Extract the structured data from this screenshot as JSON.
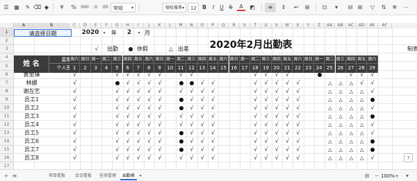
{
  "toolbar": {
    "format_select": "常规",
    "font_family": "微软雅黑",
    "font_size": "12",
    "bold": "B",
    "italic": "I",
    "underline": "U",
    "strike": "S",
    "font_color": "A",
    "percent": "%",
    "thousands": "000",
    "decimal_inc": ".0",
    "decimal_dec": ".00"
  },
  "columns": [
    "A",
    "B",
    "C",
    "D",
    "E",
    "F",
    "G",
    "H",
    "I",
    "J",
    "K",
    "L",
    "M",
    "N",
    "O",
    "P",
    "Q",
    "R",
    "S",
    "T",
    "U",
    "V",
    "W",
    "X",
    "Y",
    "Z",
    "AA",
    "AB",
    "AC",
    "AD",
    "AE",
    "AF"
  ],
  "rows": [
    "1",
    "2",
    "3",
    "4",
    "5",
    "6",
    "7",
    "8",
    "9",
    "10",
    "11",
    "12",
    "13",
    "14",
    "15",
    "16",
    "17"
  ],
  "sheet": {
    "select_date_label": "请选择日期",
    "year_value": "2020",
    "year_unit": "年",
    "month_value": "2",
    "month_unit": "月",
    "title": "2020年2月出勤表",
    "legend": [
      {
        "symbol": "√",
        "label": "出勤"
      },
      {
        "symbol": "●",
        "label": "休假"
      },
      {
        "symbol": "△",
        "label": "出差"
      }
    ],
    "right_label": "制表",
    "name_header": "姓 名",
    "weekday_header": "星期",
    "sign_header": "个人签字",
    "weekdays": [
      "周六",
      "周日",
      "周一",
      "周二",
      "周三",
      "周四",
      "周五",
      "周六",
      "周日",
      "周一",
      "周二",
      "周三",
      "周四",
      "周五",
      "周六",
      "周日",
      "周一",
      "周二",
      "周三",
      "周四",
      "周五",
      "周六",
      "周日",
      "周一",
      "周二",
      "周三",
      "周四",
      "周五",
      "周六"
    ],
    "days": [
      "1",
      "2",
      "3",
      "4",
      "5",
      "6",
      "7",
      "8",
      "9",
      "10",
      "11",
      "12",
      "13",
      "14",
      "15",
      "16",
      "17",
      "18",
      "19",
      "20",
      "21",
      "22",
      "23",
      "24",
      "25",
      "26",
      "27",
      "28",
      "29"
    ],
    "employees": [
      {
        "name": "黄金锋",
        "marks": "c...ccccc.cc.....cccc..d..ccccc"
      },
      {
        "name": "林娜",
        "marks": "c...dcccc.ddcc...ccccc..tttcc"
      },
      {
        "name": "谢左艺",
        "marks": "c...ccccc.cccc...ccccc..ttttc"
      },
      {
        "name": "员工1",
        "marks": "c...ccccc.dccc...ccccc..ttttd"
      },
      {
        "name": "员工2",
        "marks": "c...ccccc.dccc...ccccc..ttttc"
      },
      {
        "name": "员工3",
        "marks": "c...ccccc.cccc...ccccc..ttttd"
      },
      {
        "name": "员工4",
        "marks": "c...ccccc.cccc...ccccc..ttttc"
      },
      {
        "name": "员工5",
        "marks": "c...ccccc.dccc...ccccc..ttttc"
      },
      {
        "name": "员工6",
        "marks": "c...ccccc.dccc...ccccc..ttttd"
      },
      {
        "name": "员工7",
        "marks": "c...ccccc.dccc...ccccc..ttttd"
      },
      {
        "name": "员工8",
        "marks": "c...ccccc.cccc...ccccc..ttttc"
      }
    ]
  },
  "sheet_tabs": [
    {
      "label": "项目看板",
      "active": false
    },
    {
      "label": "会议看板",
      "active": false
    },
    {
      "label": "任务管理",
      "active": false
    },
    {
      "label": "出勤表",
      "active": true
    }
  ],
  "status": {
    "zoom": "100%"
  }
}
